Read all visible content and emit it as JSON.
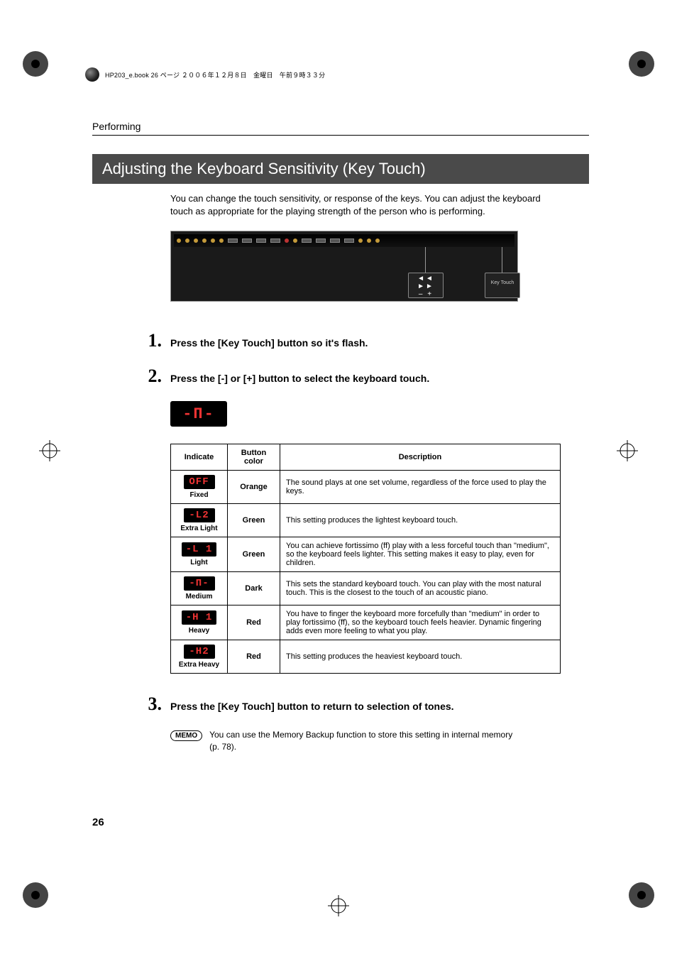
{
  "header_line": "HP203_e.book 26 ページ ２００６年１２月８日　金曜日　午前９時３３分",
  "section_label": "Performing",
  "heading": "Adjusting the Keyboard Sensitivity (Key Touch)",
  "intro": "You can change the touch sensitivity, or response of the keys. You can adjust the keyboard touch as appropriate for the playing strength of the person who is performing.",
  "panel": {
    "left_callout_top": "◄◄   ►►",
    "left_callout_bottom": "–    +",
    "right_callout": "Key Touch"
  },
  "steps": {
    "s1_num": "1.",
    "s1_text": "Press the [Key Touch] button so it's flash.",
    "s2_num": "2.",
    "s2_text": "Press the [-] or [+] button to select the keyboard touch.",
    "s3_num": "3.",
    "s3_text": "Press the [Key Touch] button to return to selection of tones."
  },
  "display_big": "-П-",
  "table": {
    "h_indicate": "Indicate",
    "h_button_color": "Button color",
    "h_description": "Description",
    "rows": [
      {
        "seg": "OFF",
        "label": "Fixed",
        "color": "Orange",
        "desc": "The sound plays at one set volume, regardless of the force used to play the keys."
      },
      {
        "seg": "-L2",
        "label": "Extra Light",
        "color": "Green",
        "desc": "This setting produces the lightest keyboard touch."
      },
      {
        "seg": "-L 1",
        "label": "Light",
        "color": "Green",
        "desc": "You can achieve fortissimo (ff) play with a less forceful touch than \"medium\", so the keyboard feels lighter. This setting makes it easy to play, even for children."
      },
      {
        "seg": "-П-",
        "label": "Medium",
        "color": "Dark",
        "desc": "This sets the standard keyboard touch. You can play with the most natural touch. This is the closest to the touch of an acoustic piano."
      },
      {
        "seg": "-H 1",
        "label": "Heavy",
        "color": "Red",
        "desc": "You have to finger the keyboard more forcefully than \"medium\" in order to play fortissimo (ff), so the keyboard touch feels heavier. Dynamic fingering adds even more feeling to what you play."
      },
      {
        "seg": "-H2",
        "label": "Extra Heavy",
        "color": "Red",
        "desc": "This setting produces the heaviest keyboard touch."
      }
    ]
  },
  "memo_label": "MEMO",
  "memo_text": "You can use the Memory Backup function to store this setting in internal memory (p. 78).",
  "page_number": "26"
}
